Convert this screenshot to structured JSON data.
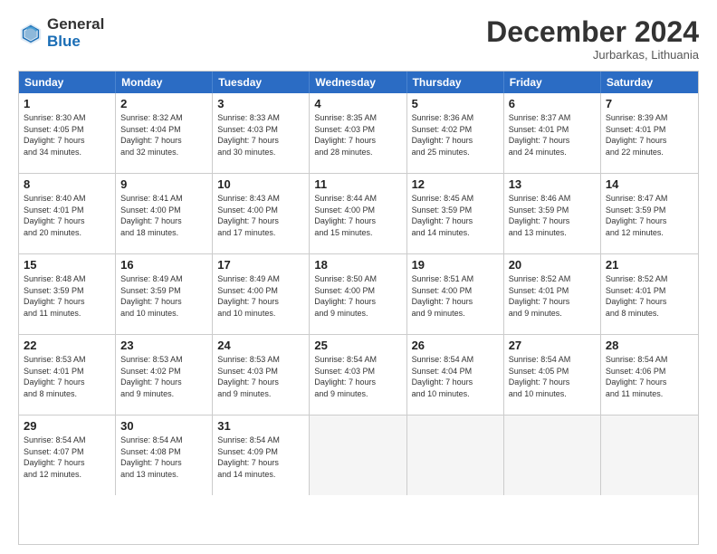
{
  "header": {
    "logo_general": "General",
    "logo_blue": "Blue",
    "month_title": "December 2024",
    "location": "Jurbarkas, Lithuania"
  },
  "weekdays": [
    "Sunday",
    "Monday",
    "Tuesday",
    "Wednesday",
    "Thursday",
    "Friday",
    "Saturday"
  ],
  "weeks": [
    [
      {
        "day": "1",
        "text": "Sunrise: 8:30 AM\nSunset: 4:05 PM\nDaylight: 7 hours\nand 34 minutes."
      },
      {
        "day": "2",
        "text": "Sunrise: 8:32 AM\nSunset: 4:04 PM\nDaylight: 7 hours\nand 32 minutes."
      },
      {
        "day": "3",
        "text": "Sunrise: 8:33 AM\nSunset: 4:03 PM\nDaylight: 7 hours\nand 30 minutes."
      },
      {
        "day": "4",
        "text": "Sunrise: 8:35 AM\nSunset: 4:03 PM\nDaylight: 7 hours\nand 28 minutes."
      },
      {
        "day": "5",
        "text": "Sunrise: 8:36 AM\nSunset: 4:02 PM\nDaylight: 7 hours\nand 25 minutes."
      },
      {
        "day": "6",
        "text": "Sunrise: 8:37 AM\nSunset: 4:01 PM\nDaylight: 7 hours\nand 24 minutes."
      },
      {
        "day": "7",
        "text": "Sunrise: 8:39 AM\nSunset: 4:01 PM\nDaylight: 7 hours\nand 22 minutes."
      }
    ],
    [
      {
        "day": "8",
        "text": "Sunrise: 8:40 AM\nSunset: 4:01 PM\nDaylight: 7 hours\nand 20 minutes."
      },
      {
        "day": "9",
        "text": "Sunrise: 8:41 AM\nSunset: 4:00 PM\nDaylight: 7 hours\nand 18 minutes."
      },
      {
        "day": "10",
        "text": "Sunrise: 8:43 AM\nSunset: 4:00 PM\nDaylight: 7 hours\nand 17 minutes."
      },
      {
        "day": "11",
        "text": "Sunrise: 8:44 AM\nSunset: 4:00 PM\nDaylight: 7 hours\nand 15 minutes."
      },
      {
        "day": "12",
        "text": "Sunrise: 8:45 AM\nSunset: 3:59 PM\nDaylight: 7 hours\nand 14 minutes."
      },
      {
        "day": "13",
        "text": "Sunrise: 8:46 AM\nSunset: 3:59 PM\nDaylight: 7 hours\nand 13 minutes."
      },
      {
        "day": "14",
        "text": "Sunrise: 8:47 AM\nSunset: 3:59 PM\nDaylight: 7 hours\nand 12 minutes."
      }
    ],
    [
      {
        "day": "15",
        "text": "Sunrise: 8:48 AM\nSunset: 3:59 PM\nDaylight: 7 hours\nand 11 minutes."
      },
      {
        "day": "16",
        "text": "Sunrise: 8:49 AM\nSunset: 3:59 PM\nDaylight: 7 hours\nand 10 minutes."
      },
      {
        "day": "17",
        "text": "Sunrise: 8:49 AM\nSunset: 4:00 PM\nDaylight: 7 hours\nand 10 minutes."
      },
      {
        "day": "18",
        "text": "Sunrise: 8:50 AM\nSunset: 4:00 PM\nDaylight: 7 hours\nand 9 minutes."
      },
      {
        "day": "19",
        "text": "Sunrise: 8:51 AM\nSunset: 4:00 PM\nDaylight: 7 hours\nand 9 minutes."
      },
      {
        "day": "20",
        "text": "Sunrise: 8:52 AM\nSunset: 4:01 PM\nDaylight: 7 hours\nand 9 minutes."
      },
      {
        "day": "21",
        "text": "Sunrise: 8:52 AM\nSunset: 4:01 PM\nDaylight: 7 hours\nand 8 minutes."
      }
    ],
    [
      {
        "day": "22",
        "text": "Sunrise: 8:53 AM\nSunset: 4:01 PM\nDaylight: 7 hours\nand 8 minutes."
      },
      {
        "day": "23",
        "text": "Sunrise: 8:53 AM\nSunset: 4:02 PM\nDaylight: 7 hours\nand 9 minutes."
      },
      {
        "day": "24",
        "text": "Sunrise: 8:53 AM\nSunset: 4:03 PM\nDaylight: 7 hours\nand 9 minutes."
      },
      {
        "day": "25",
        "text": "Sunrise: 8:54 AM\nSunset: 4:03 PM\nDaylight: 7 hours\nand 9 minutes."
      },
      {
        "day": "26",
        "text": "Sunrise: 8:54 AM\nSunset: 4:04 PM\nDaylight: 7 hours\nand 10 minutes."
      },
      {
        "day": "27",
        "text": "Sunrise: 8:54 AM\nSunset: 4:05 PM\nDaylight: 7 hours\nand 10 minutes."
      },
      {
        "day": "28",
        "text": "Sunrise: 8:54 AM\nSunset: 4:06 PM\nDaylight: 7 hours\nand 11 minutes."
      }
    ],
    [
      {
        "day": "29",
        "text": "Sunrise: 8:54 AM\nSunset: 4:07 PM\nDaylight: 7 hours\nand 12 minutes."
      },
      {
        "day": "30",
        "text": "Sunrise: 8:54 AM\nSunset: 4:08 PM\nDaylight: 7 hours\nand 13 minutes."
      },
      {
        "day": "31",
        "text": "Sunrise: 8:54 AM\nSunset: 4:09 PM\nDaylight: 7 hours\nand 14 minutes."
      },
      {
        "day": "",
        "text": ""
      },
      {
        "day": "",
        "text": ""
      },
      {
        "day": "",
        "text": ""
      },
      {
        "day": "",
        "text": ""
      }
    ]
  ]
}
